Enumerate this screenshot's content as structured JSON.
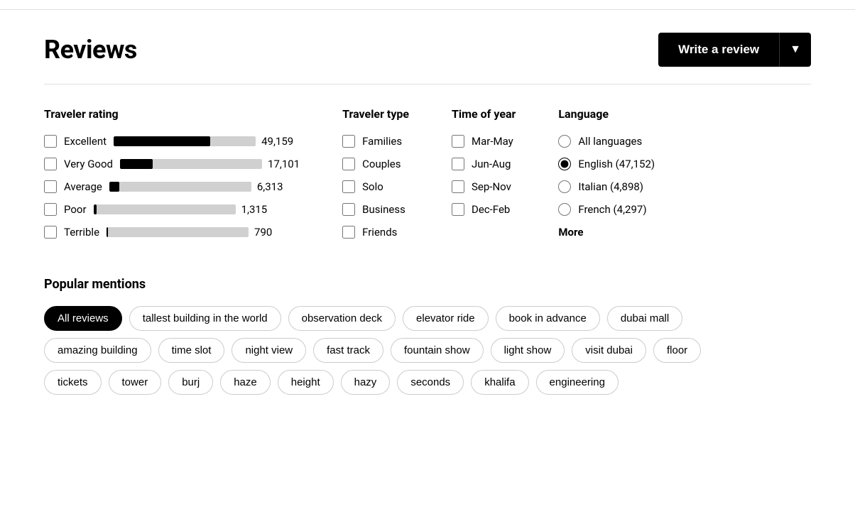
{
  "header": {
    "title": "Reviews",
    "write_review_label": "Write a review",
    "dropdown_icon": "▼"
  },
  "traveler_rating": {
    "section_title": "Traveler rating",
    "items": [
      {
        "label": "Excellent",
        "count": "49,159",
        "bar_pct": 68
      },
      {
        "label": "Very Good",
        "count": "17,101",
        "bar_pct": 23
      },
      {
        "label": "Average",
        "count": "6,313",
        "bar_pct": 7
      },
      {
        "label": "Poor",
        "count": "1,315",
        "bar_pct": 2
      },
      {
        "label": "Terrible",
        "count": "790",
        "bar_pct": 1
      }
    ]
  },
  "traveler_type": {
    "section_title": "Traveler type",
    "items": [
      {
        "label": "Families"
      },
      {
        "label": "Couples"
      },
      {
        "label": "Solo"
      },
      {
        "label": "Business"
      },
      {
        "label": "Friends"
      }
    ]
  },
  "time_of_year": {
    "section_title": "Time of year",
    "items": [
      {
        "label": "Mar-May"
      },
      {
        "label": "Jun-Aug"
      },
      {
        "label": "Sep-Nov"
      },
      {
        "label": "Dec-Feb"
      }
    ]
  },
  "language": {
    "section_title": "Language",
    "items": [
      {
        "label": "All languages",
        "checked": false
      },
      {
        "label": "English (47,152)",
        "checked": true
      },
      {
        "label": "Italian (4,898)",
        "checked": false
      },
      {
        "label": "French (4,297)",
        "checked": false
      }
    ],
    "more_label": "More"
  },
  "popular_mentions": {
    "section_title": "Popular mentions",
    "tags_row1": [
      {
        "label": "All reviews",
        "active": true
      },
      {
        "label": "tallest building in the world",
        "active": false
      },
      {
        "label": "observation deck",
        "active": false
      },
      {
        "label": "elevator ride",
        "active": false
      },
      {
        "label": "book in advance",
        "active": false
      },
      {
        "label": "dubai mall",
        "active": false
      }
    ],
    "tags_row2": [
      {
        "label": "amazing building",
        "active": false
      },
      {
        "label": "time slot",
        "active": false
      },
      {
        "label": "night view",
        "active": false
      },
      {
        "label": "fast track",
        "active": false
      },
      {
        "label": "fountain show",
        "active": false
      },
      {
        "label": "light show",
        "active": false
      },
      {
        "label": "visit dubai",
        "active": false
      },
      {
        "label": "floor",
        "active": false
      }
    ],
    "tags_row3": [
      {
        "label": "tickets",
        "active": false
      },
      {
        "label": "tower",
        "active": false
      },
      {
        "label": "burj",
        "active": false
      },
      {
        "label": "haze",
        "active": false
      },
      {
        "label": "height",
        "active": false
      },
      {
        "label": "hazy",
        "active": false
      },
      {
        "label": "seconds",
        "active": false
      },
      {
        "label": "khalifa",
        "active": false
      },
      {
        "label": "engineering",
        "active": false
      }
    ]
  }
}
